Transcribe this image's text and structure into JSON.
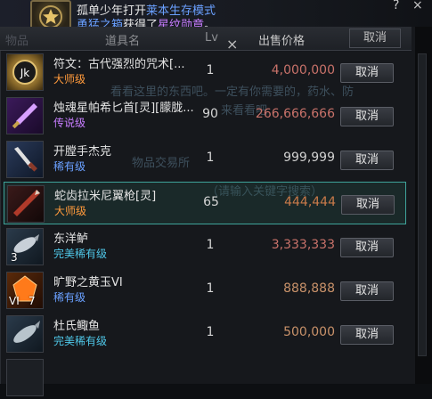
{
  "notice": {
    "line1_a": "孤单少年打开",
    "line1_b": "莱本生存模式",
    "line2_a": "勇猛之箱",
    "line2_b": "获得了",
    "line2_c": "星纹勋章",
    "line2_d": "。"
  },
  "top_icons": {
    "help": "?",
    "close": "×"
  },
  "header": {
    "col_item_ghost": "物品",
    "col_name": "道具名",
    "col_lv": "Lv",
    "col_price": "出售价格",
    "col_cancel": "取消",
    "close": "×"
  },
  "ghost_text": {
    "line1": "看看这里的东西吧。一定有你需要的，药水、防",
    "line2": "来看看吧",
    "line3": "物品交易所",
    "line4": "（请输入关键字搜索）"
  },
  "rows": [
    {
      "name": "符文：古代强烈的咒术[...",
      "grade": "大师级",
      "lv": "1",
      "price": "4,000,000",
      "button": "取消",
      "stack": "",
      "icon": "rune-icon"
    },
    {
      "name": "烛魂星帕希匕首[灵][朦胧...",
      "grade": "传说级",
      "lv": "90",
      "price": "266,666,666",
      "button": "取消",
      "stack": "",
      "icon": "dagger-icon"
    },
    {
      "name": "开膛手杰克",
      "grade": "稀有级",
      "lv": "1",
      "price": "999,999",
      "button": "取消",
      "stack": "",
      "icon": "knife-icon"
    },
    {
      "name": "蛇齿拉米尼翼枪[灵]",
      "grade": "大师级",
      "lv": "65",
      "price": "444,444",
      "button": "取消",
      "stack": "",
      "icon": "spear-icon"
    },
    {
      "name": "东洋鲈",
      "grade": "完美稀有级",
      "lv": "1",
      "price": "3,333,333",
      "button": "取消",
      "stack": "3",
      "icon": "fish-icon"
    },
    {
      "name": "旷野之黄玉VI",
      "grade": "稀有级",
      "lv": "1",
      "price": "888,888",
      "button": "取消",
      "stack": "7",
      "stack_left": "VI",
      "icon": "topaz-icon"
    },
    {
      "name": "杜氏鲰鱼",
      "grade": "完美稀有级",
      "lv": "1",
      "price": "500,000",
      "button": "取消",
      "stack": "",
      "icon": "fish-icon"
    }
  ],
  "colors": {
    "master": "#ff9a3c",
    "legend": "#c77dff",
    "rare": "#6aa0ff",
    "perfect_rare": "#4fc7e8",
    "selected_border": "#3fa39a"
  }
}
